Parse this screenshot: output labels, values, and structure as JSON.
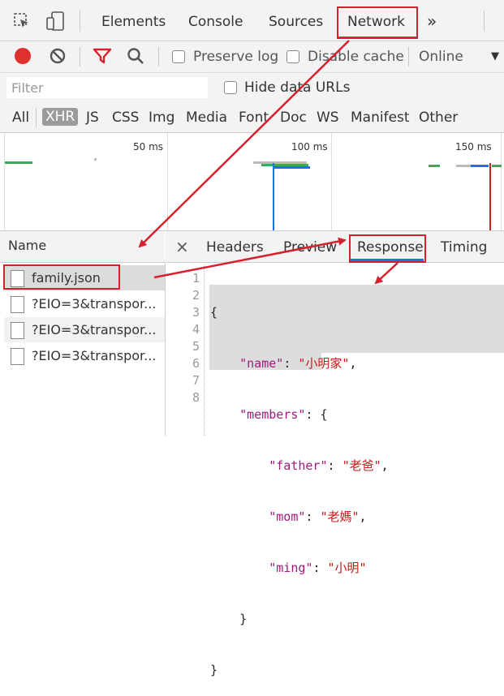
{
  "toolbar": {
    "tabs": [
      "Elements",
      "Console",
      "Sources",
      "Network"
    ],
    "active_tab": "Network",
    "more": "»"
  },
  "network_bar": {
    "preserve_log": "Preserve log",
    "disable_cache": "Disable cache",
    "throttle": "Online"
  },
  "filter": {
    "placeholder": "Filter",
    "hide_data_urls": "Hide data URLs"
  },
  "types": [
    "All",
    "XHR",
    "JS",
    "CSS",
    "Img",
    "Media",
    "Font",
    "Doc",
    "WS",
    "Manifest",
    "Other"
  ],
  "active_type": "XHR",
  "timeline": {
    "ticks": [
      "50 ms",
      "100 ms",
      "150 ms"
    ]
  },
  "requests": {
    "header": "Name",
    "items": [
      "family.json",
      "?EIO=3&transpor...",
      "?EIO=3&transpor...",
      "?EIO=3&transpor..."
    ]
  },
  "detail_tabs": {
    "close": "×",
    "tabs": [
      "Headers",
      "Preview",
      "Response",
      "Timing"
    ],
    "active": "Response"
  },
  "response": {
    "line_numbers": [
      "1",
      "2",
      "3",
      "4",
      "5",
      "6",
      "7",
      "8"
    ],
    "lines": [
      {
        "a": "{"
      },
      {
        "k": "\"name\"",
        "b": ": ",
        "s": "\"小明家\"",
        "c": ","
      },
      {
        "k": "\"members\"",
        "b": ": {"
      },
      {
        "k": "\"father\"",
        "b": ": ",
        "s": "\"老爸\"",
        "c": ","
      },
      {
        "k": "\"mom\"",
        "b": ": ",
        "s": "\"老媽\"",
        "c": ","
      },
      {
        "k": "\"ming\"",
        "b": ": ",
        "s": "\"小明\""
      },
      {
        "a": "}"
      },
      {
        "a": "}"
      }
    ]
  },
  "colors": {
    "accent": "#1a73e8",
    "annotation": "#d6202c",
    "record": "#e0302d"
  }
}
